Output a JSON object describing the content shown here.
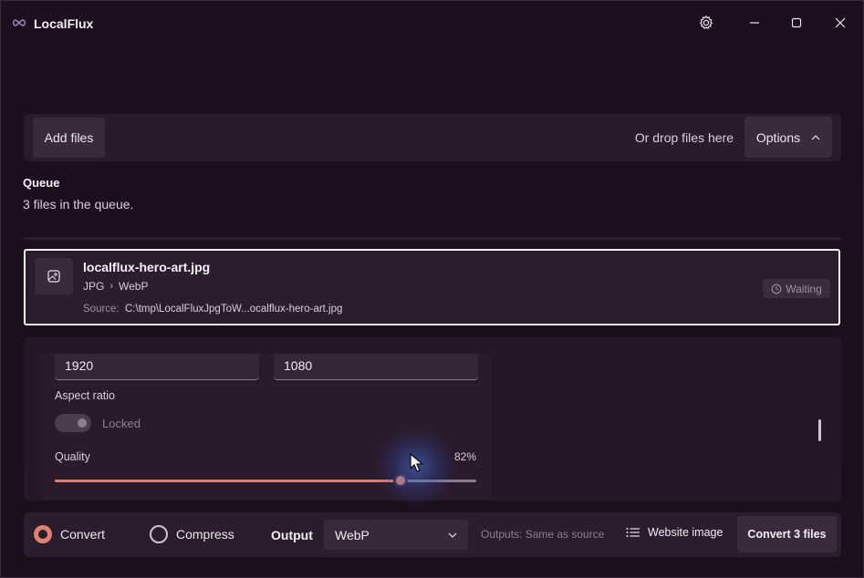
{
  "app": {
    "title": "LocalFlux"
  },
  "toolbar": {
    "add_files_label": "Add files",
    "drop_text": "Or drop files here",
    "options_label": "Options"
  },
  "queue": {
    "title": "Queue",
    "count_text": "3 files in the queue.",
    "items": [
      {
        "name": "localflux-hero-art.jpg",
        "from": "JPG",
        "to": "WebP",
        "source_label": "Source:",
        "source_path": "C:\\tmp\\LocalFluxJpgToW...ocalflux-hero-art.jpg",
        "status": "Waiting"
      }
    ]
  },
  "settings": {
    "width": "1920",
    "height": "1080",
    "aspect_label": "Aspect ratio",
    "aspect_toggle_text": "Locked",
    "aspect_locked": true,
    "quality_label": "Quality",
    "quality_value": "82%",
    "quality_fraction": 0.82
  },
  "bottom": {
    "convert_label": "Convert",
    "compress_label": "Compress",
    "selected_mode": "Convert",
    "output_label": "Output",
    "output_value": "WebP",
    "outputs_note": "Outputs: Same as source",
    "website_image_label": "Website image",
    "convert_files_label": "Convert 3 files"
  },
  "colors": {
    "accent": "#e08070",
    "background": "#1d0f1f",
    "card": "#2b1c2e"
  },
  "icons": {
    "logo": "infinity-logo-icon",
    "settings": "gear-icon",
    "minimize": "minimize-icon",
    "maximize": "maximize-icon",
    "close": "close-icon",
    "options_chevron": "chevron-up-icon",
    "file_thumb": "image-icon",
    "status": "clock-icon",
    "select_chevron": "chevron-down-icon",
    "website": "list-icon"
  }
}
